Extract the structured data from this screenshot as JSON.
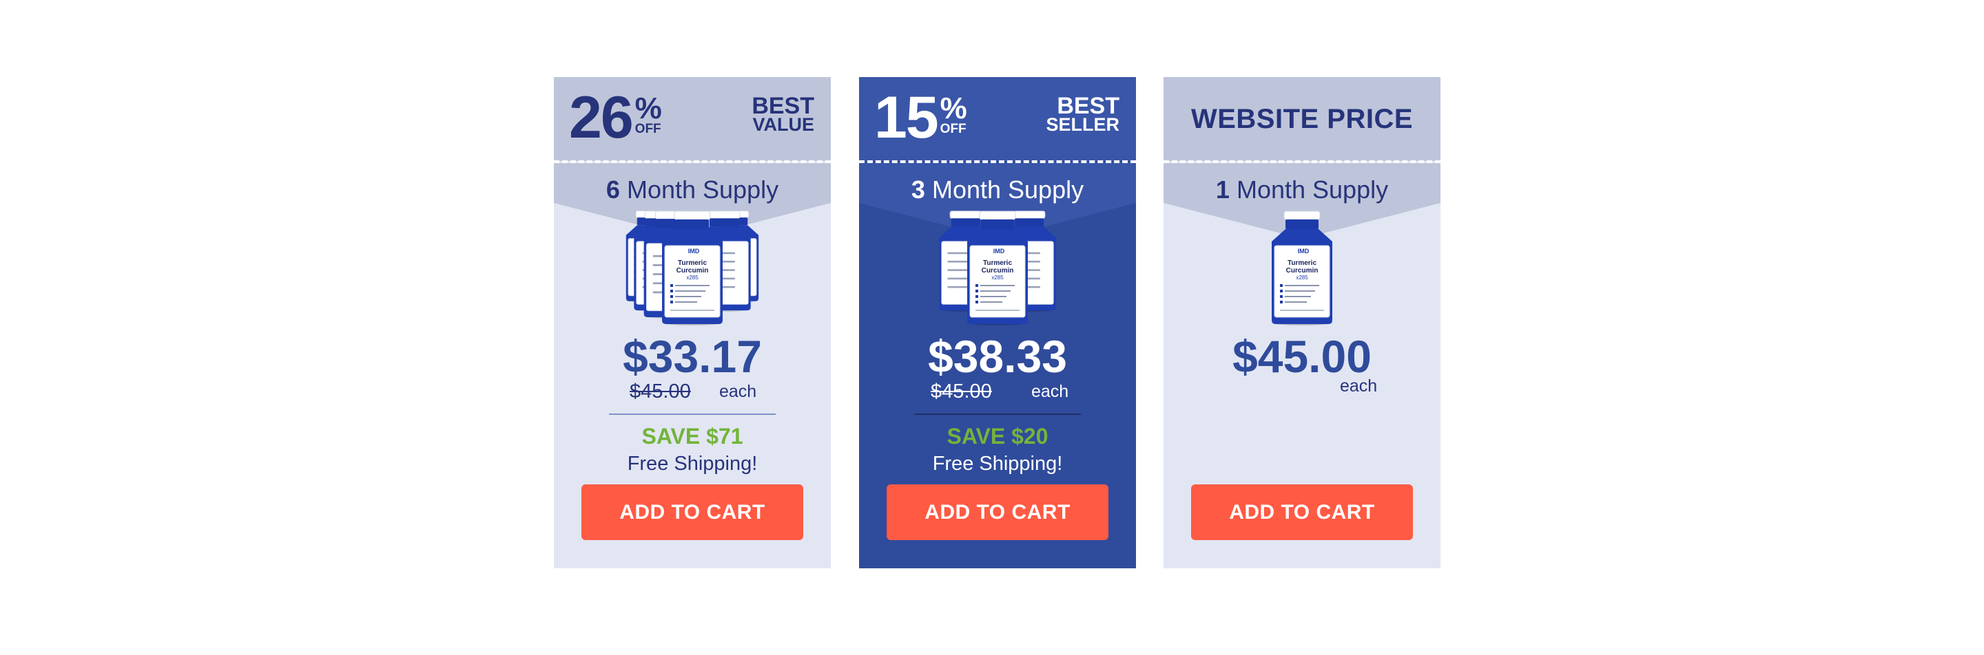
{
  "colors": {
    "navy": "#27337a",
    "brand_blue": "#2f4b9b",
    "light_card": "#e2e6f3",
    "light_header": "#bec5da",
    "save_green": "#73b43a",
    "button_red": "#ff5a43"
  },
  "cards": [
    {
      "discount_number": "26",
      "discount_percent": "%",
      "discount_off": "OFF",
      "tag_line1": "BEST",
      "tag_line2": "VALUE",
      "supply_count": "6",
      "supply_label": "Month Supply",
      "bottles": 6,
      "price": "$33.17",
      "was_price": "$45.00",
      "each_label": "each",
      "save_label": "SAVE $71",
      "shipping_label": "Free Shipping!",
      "button_label": "ADD TO CART"
    },
    {
      "discount_number": "15",
      "discount_percent": "%",
      "discount_off": "OFF",
      "tag_line1": "BEST",
      "tag_line2": "SELLER",
      "supply_count": "3",
      "supply_label": "Month Supply",
      "bottles": 3,
      "price": "$38.33",
      "was_price": "$45.00",
      "each_label": "each",
      "save_label": "SAVE $20",
      "shipping_label": "Free Shipping!",
      "button_label": "ADD TO CART"
    },
    {
      "header_label": "WEBSITE PRICE",
      "supply_count": "1",
      "supply_label": "Month Supply",
      "bottles": 1,
      "price": "$45.00",
      "each_label": "each",
      "button_label": "ADD TO CART"
    }
  ],
  "product": {
    "brand": "IMD",
    "name_line1": "Turmeric",
    "name_line2": "Curcumin",
    "name_line3": "x285"
  }
}
